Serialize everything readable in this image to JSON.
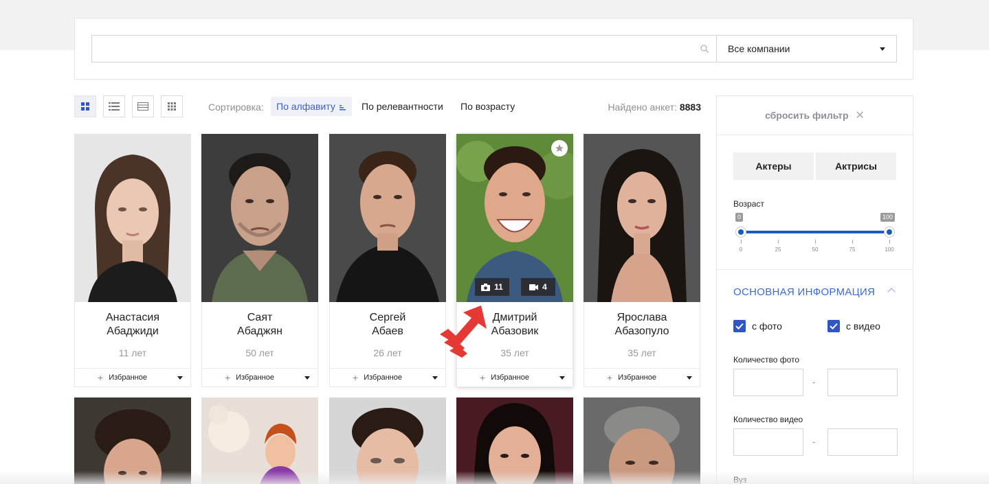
{
  "search": {
    "placeholder": "",
    "company_select": "Все компании"
  },
  "views": [
    "grid-large-icon",
    "list-icon",
    "table-icon",
    "grid-small-icon"
  ],
  "sort": {
    "label": "Сортировка:",
    "options": [
      "По алфавиту",
      "По релевантности",
      "По возрасту"
    ],
    "active": "По алфавиту"
  },
  "found": {
    "label": "Найдено анкет:",
    "count": "8883"
  },
  "profiles": [
    {
      "first": "Анастасия",
      "last": "Абаджиди",
      "age": "11 лет",
      "fav": "Избранное"
    },
    {
      "first": "Саят",
      "last": "Абаджян",
      "age": "50 лет",
      "fav": "Избранное"
    },
    {
      "first": "Сергей",
      "last": "Абаев",
      "age": "26 лет",
      "fav": "Избранное"
    },
    {
      "first": "Дмитрий",
      "last": "Абазовик",
      "age": "35 лет",
      "fav": "Избранное",
      "photos": "11",
      "videos": "4"
    },
    {
      "first": "Ярослава",
      "last": "Абазопуло",
      "age": "35 лет",
      "fav": "Избранное"
    }
  ],
  "filter": {
    "reset": "сбросить фильтр",
    "gender": [
      "Актеры",
      "Актрисы"
    ],
    "age_label": "Возраст",
    "age_min": "0",
    "age_max": "100",
    "age_ticks": [
      "0",
      "25",
      "50",
      "75",
      "100"
    ],
    "section_title": "ОСНОВНАЯ ИНФОРМАЦИЯ",
    "with_photo": "с фото",
    "with_video": "с видео",
    "photo_count_label": "Количество фото",
    "video_count_label": "Количество видео",
    "university_label": "Вуз",
    "range_dash": "-"
  },
  "colors": {
    "accent": "#3b6bd1",
    "slider": "#1a5bbf",
    "checkbox": "#2f55c7",
    "arrow": "#e53935"
  }
}
